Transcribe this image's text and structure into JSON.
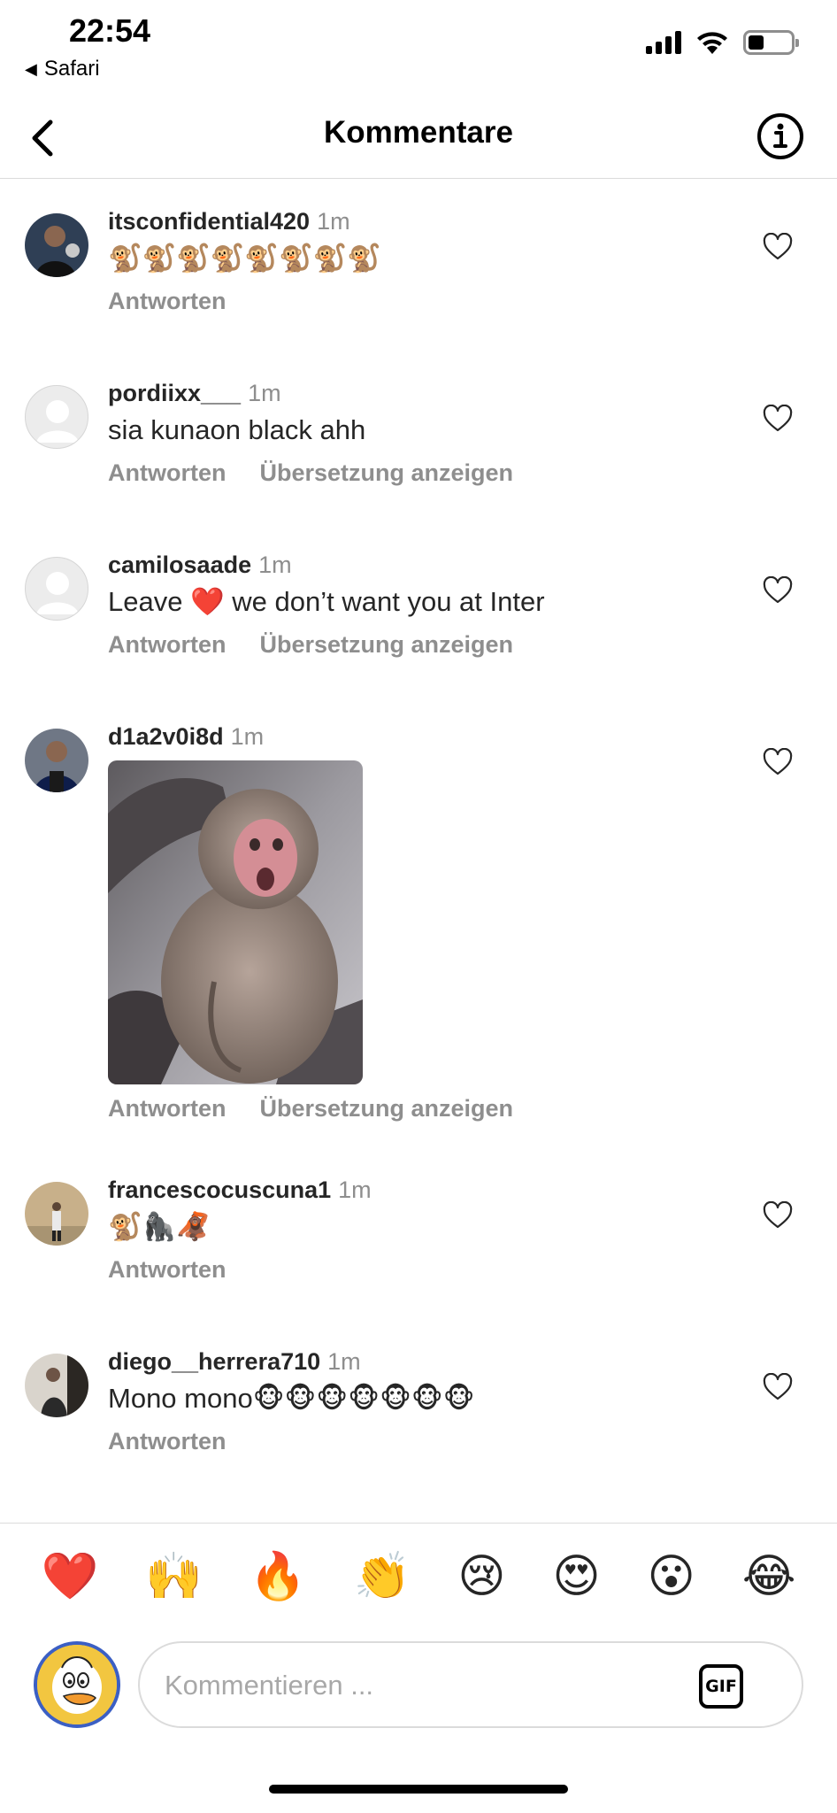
{
  "status_bar": {
    "time": "22:54",
    "back_app": "Safari",
    "back_icon": "back-triangle-icon",
    "signal_icon": "cellular-signal-icon",
    "wifi_icon": "wifi-icon",
    "battery_icon": "battery-icon"
  },
  "header": {
    "title": "Kommentare",
    "back_icon": "chevron-left-icon",
    "info_icon": "info-icon"
  },
  "comments": [
    {
      "username": "itsconfidential420",
      "time": "1m",
      "text": "🐒🐒🐒🐒🐒🐒🐒🐒",
      "reply_label": "Antworten",
      "translate_label": ""
    },
    {
      "username": "pordiixx___",
      "time": "1m",
      "text": "sia kunaon black ahh",
      "reply_label": "Antworten",
      "translate_label": "Übersetzung anzeigen"
    },
    {
      "username": "camilosaade",
      "time": "1m",
      "text": "Leave ❤️ we don’t want you at Inter",
      "reply_label": "Antworten",
      "translate_label": "Übersetzung anzeigen"
    },
    {
      "username": "d1a2v0i8d",
      "time": "1m",
      "text": "",
      "media": "gif-shocked-monkey",
      "reply_label": "Antworten",
      "translate_label": "Übersetzung anzeigen"
    },
    {
      "username": "francescocuscuna1",
      "time": "1m",
      "text": "🐒🦍🦧",
      "reply_label": "Antworten",
      "translate_label": ""
    },
    {
      "username": "diego__herrera710",
      "time": "1m",
      "text": "Mono mono🐵🐵🐵🐵🐵🐵🐵",
      "reply_label": "Antworten",
      "translate_label": ""
    }
  ],
  "reactions": [
    "❤️",
    "🙌",
    "🔥",
    "👏",
    "😢",
    "😍",
    "😮",
    "😂"
  ],
  "composer": {
    "placeholder": "Kommentieren ...",
    "gif_label": "GIF"
  },
  "colors": {
    "text": "#262626",
    "secondary": "#8e8e8e",
    "divider": "#dbdbdb"
  }
}
